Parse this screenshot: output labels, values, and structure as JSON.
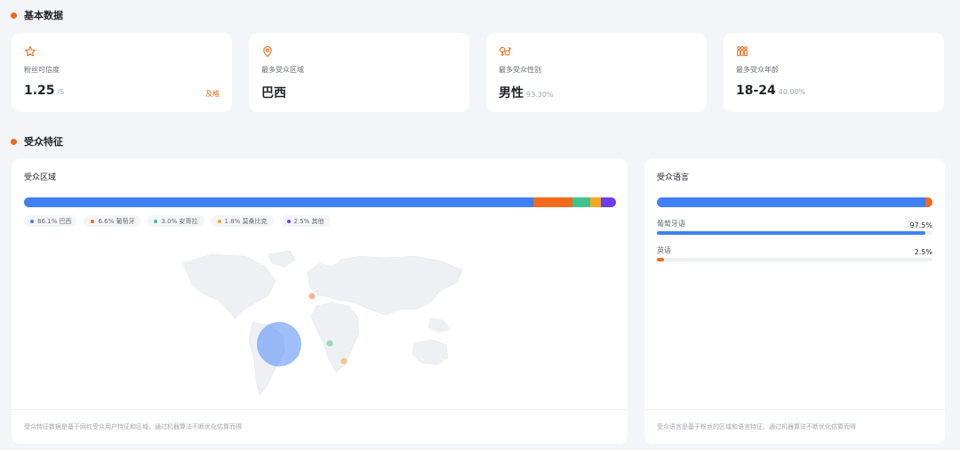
{
  "basic": {
    "title": "基本数据",
    "stats": [
      {
        "icon": "star-icon",
        "label": "粉丝可信度",
        "value": "1.25",
        "sub": "/5",
        "tag": "及格"
      },
      {
        "icon": "location-pin-icon",
        "label": "最多受众区域",
        "value": "巴西",
        "sub": "",
        "tag": ""
      },
      {
        "icon": "gender-icon",
        "label": "最多受众性别",
        "value": "男性",
        "sub": "93.30%",
        "tag": ""
      },
      {
        "icon": "people-icon",
        "label": "最多受众年龄",
        "value": "18-24",
        "sub": "40.00%",
        "tag": ""
      }
    ]
  },
  "audience": {
    "title": "受众特征",
    "region": {
      "title": "受众区域",
      "items": [
        {
          "pct": 86.1,
          "text": "86.1% 巴西",
          "color": "#3f7ff7"
        },
        {
          "pct": 6.6,
          "text": "6.6% 葡萄牙",
          "color": "#f26a1b"
        },
        {
          "pct": 3.0,
          "text": "3.0% 安哥拉",
          "color": "#3ec48a"
        },
        {
          "pct": 1.8,
          "text": "1.8% 莫桑比克",
          "color": "#f5a623"
        },
        {
          "pct": 2.5,
          "text": "2.5% 其他",
          "color": "#6c3ef0"
        }
      ],
      "footnote": "受众特征数据是基于网红受众用户特征和区域，通过机器算法不断优化估算而得"
    },
    "language": {
      "title": "受众语言",
      "items": [
        {
          "name": "葡萄牙语",
          "pct": 97.5,
          "pct_text": "97.5%",
          "color": "#3f7ff7"
        },
        {
          "name": "英语",
          "pct": 2.5,
          "pct_text": "2.5%",
          "color": "#f26a1b"
        }
      ],
      "footnote": "受众语言是基于粉丝的区域和语言特征，通过机器算法不断优化估算而得"
    }
  }
}
